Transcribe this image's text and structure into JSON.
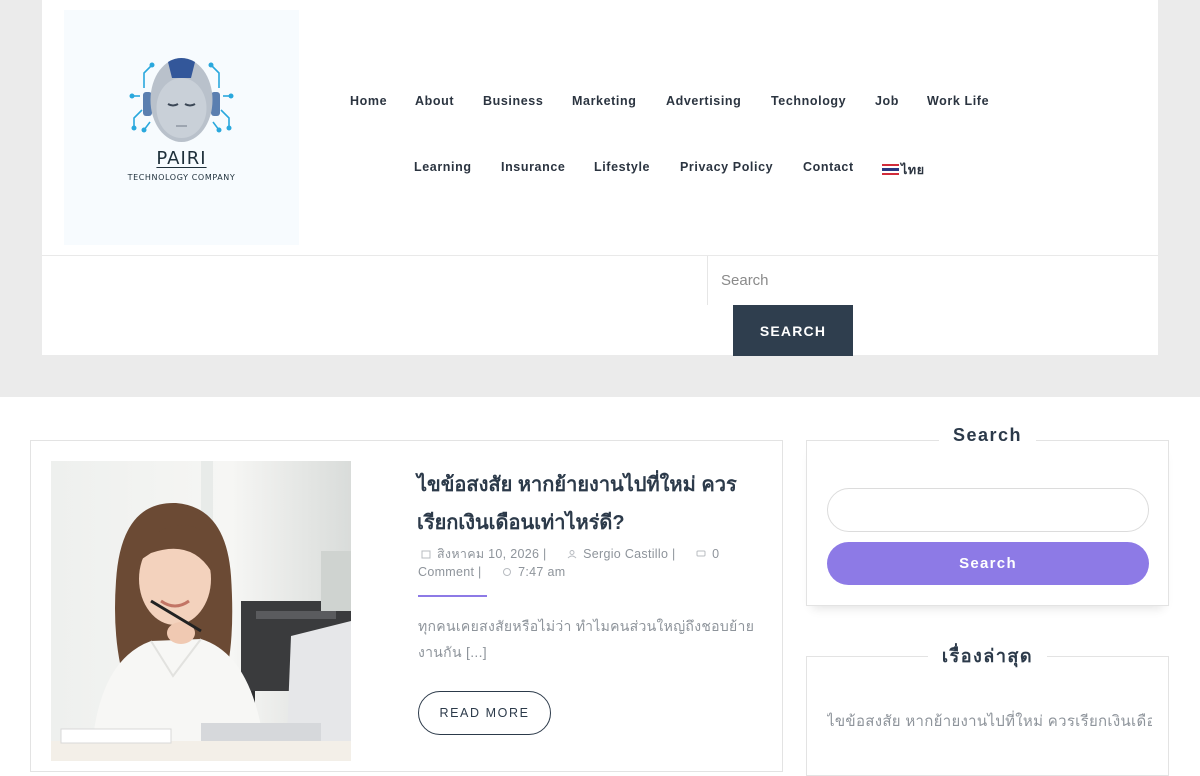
{
  "site": {
    "logo_name": "PAIRI",
    "logo_tagline": "TECHNOLOGY COMPANY"
  },
  "nav": {
    "row1": [
      "Home",
      "About",
      "Business",
      "Marketing",
      "Advertising",
      "Technology",
      "Job",
      "Work Life"
    ],
    "row2": [
      "Learning",
      "Insurance",
      "Lifestyle",
      "Privacy Policy",
      "Contact"
    ],
    "language": "ไทย"
  },
  "header_search": {
    "placeholder": "Search",
    "button_label": "SEARCH"
  },
  "post": {
    "title": "ไขข้อสงสัย หากย้ายงานไปที่ใหม่ ควรเรียกเงินเดือนเท่าไหร่ดี?",
    "date": "สิงหาคม 10, 2026",
    "author": "Sergio Castillo",
    "comments": "0 Comment",
    "time": "7:47 am",
    "excerpt": "ทุกคนเคยสงสัยหรือไม่ว่า ทำไมคนส่วนใหญ่ถึงชอบย้ายงานกัน [...]",
    "read_more_label": "READ MORE"
  },
  "sidebar": {
    "search_title": "Search",
    "search_placeholder": "",
    "search_button": "Search",
    "recent_title": "เรื่องล่าสุด",
    "recent_posts": [
      "ไขข้อสงสัย หากย้ายงานไปที่ใหม่ ควรเรียกเงินเดือนเท่าไหร่ดี?"
    ]
  },
  "colors": {
    "accent": "#8d7ae6",
    "dark_button": "#2f3e4e",
    "heading": "#2c3a4a",
    "muted_text": "#8e949b",
    "band": "#ebebeb"
  }
}
